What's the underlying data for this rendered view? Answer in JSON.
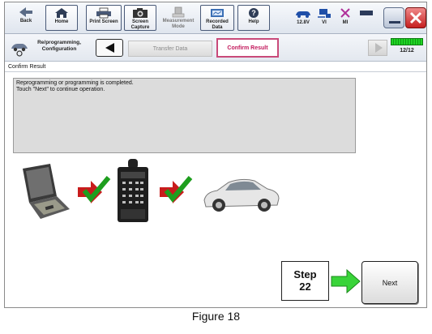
{
  "toolbar": {
    "buttons": [
      {
        "label": "Back",
        "icon": "back-arrow-icon"
      },
      {
        "label": "Home",
        "icon": "home-icon"
      },
      {
        "label": "Print Screen",
        "icon": "printer-icon"
      },
      {
        "label": "Screen Capture",
        "icon": "camera-icon"
      },
      {
        "label": "Measurement Mode",
        "icon": "measurement-icon"
      },
      {
        "label": "Recorded Data",
        "icon": "recorded-data-icon"
      },
      {
        "label": "Help",
        "icon": "help-icon"
      }
    ],
    "status": [
      {
        "label": "12.8V",
        "icon": "vehicle-battery-icon"
      },
      {
        "label": "VI",
        "icon": "vi-connection-icon"
      },
      {
        "label": "MI",
        "icon": "mi-disconnected-icon"
      }
    ]
  },
  "breadcrumb": {
    "reprog_label": "Re/programming, Configuration",
    "step_transfer": "Transfer Data",
    "step_confirm": "Confirm Result",
    "page_count": "12/12",
    "progress": 1.0
  },
  "section_title": "Confirm Result",
  "message": {
    "line1": "Reprogramming or programming is completed.",
    "line2": "Touch \"Next\" to continue operation."
  },
  "step_indicator": {
    "line1": "Step",
    "line2": "22"
  },
  "next_label": "Next",
  "caption": "Figure 18",
  "colors": {
    "active_step": "#c2185b",
    "check": "#1e9e1e",
    "arrow_red": "#c81c1c",
    "next_arrow": "#39d439"
  }
}
